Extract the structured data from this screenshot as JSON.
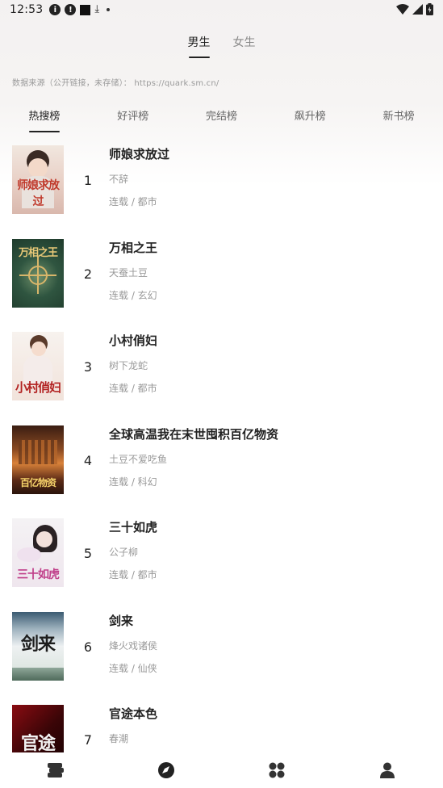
{
  "status_bar": {
    "time": "12:53"
  },
  "gender_tabs": [
    {
      "label": "男生",
      "active": true
    },
    {
      "label": "女生",
      "active": false
    }
  ],
  "source_note": "数据来源（公开链接，未存储）： https://quark.sm.cn/",
  "rank_tabs": [
    {
      "label": "热搜榜",
      "active": true
    },
    {
      "label": "好评榜",
      "active": false
    },
    {
      "label": "完结榜",
      "active": false
    },
    {
      "label": "飙升榜",
      "active": false
    },
    {
      "label": "新书榜",
      "active": false
    }
  ],
  "books": [
    {
      "rank": "1",
      "title": "师娘求放过",
      "author": "不辞",
      "meta": "连载 / 都市",
      "cover_text": "师娘求放过"
    },
    {
      "rank": "2",
      "title": "万相之王",
      "author": "天蚕土豆",
      "meta": "连载 / 玄幻",
      "cover_text": "万相之王"
    },
    {
      "rank": "3",
      "title": "小村俏妇",
      "author": "树下龙蛇",
      "meta": "连载 / 都市",
      "cover_text": "小村俏妇"
    },
    {
      "rank": "4",
      "title": "全球高温我在末世囤积百亿物资",
      "author": "土豆不爱吃鱼",
      "meta": "连载 / 科幻",
      "cover_text": "百亿物资"
    },
    {
      "rank": "5",
      "title": "三十如虎",
      "author": "公子柳",
      "meta": "连载 / 都市",
      "cover_text": "三十如虎"
    },
    {
      "rank": "6",
      "title": "剑来",
      "author": "烽火戏诸侯",
      "meta": "连载 / 仙侠",
      "cover_text": "剑来"
    },
    {
      "rank": "7",
      "title": "官途本色",
      "author": "春潮",
      "meta": "",
      "cover_text": "官途"
    }
  ],
  "bottom_nav": [
    {
      "icon": "bookshelf-icon"
    },
    {
      "icon": "compass-icon",
      "active": true
    },
    {
      "icon": "category-icon"
    },
    {
      "icon": "profile-icon"
    }
  ],
  "colors": {
    "text": "#222222",
    "muted": "#999999",
    "active_indicator": "#222222"
  }
}
